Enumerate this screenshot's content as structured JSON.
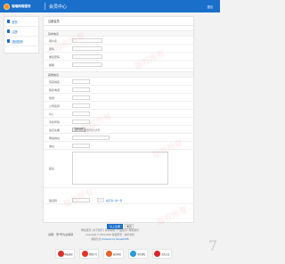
{
  "header": {
    "logo_text": "瑞瑞网络服务",
    "title": "会员中心",
    "exit_label": "退出"
  },
  "sidebar": {
    "items": [
      {
        "label": "首页",
        "icon": "home-icon"
      },
      {
        "label": "注册",
        "icon": "user-icon"
      },
      {
        "label": "找回密码",
        "icon": "key-icon"
      }
    ]
  },
  "main": {
    "title": "注册会员",
    "section_basic": "基本信息",
    "section_more": "其他信息",
    "fields": {
      "username": "用户名",
      "password": "密码",
      "confirm_password": "重复密码",
      "email": "邮箱",
      "realname": "真实姓名",
      "contact": "联系电话",
      "gender": "性别",
      "company": "公司名称",
      "qq": "QQ",
      "phone": "手机号码",
      "avatar": "会员头像",
      "homepage": "网站地址",
      "address": "地址",
      "intro": "备注",
      "captcha": "验证码"
    },
    "file_button": "选择文件",
    "file_status": "未选择任何文件",
    "captcha_link": "看不清？换一张",
    "submit_label": "马上注册",
    "reset_label": "重置",
    "tip": "说明：带*号为必填项"
  },
  "footer": {
    "line1": "网站首页 | 关于我们 | 新闻动态 | 产品展示 | 联系我们",
    "line2": "Copyright © 2019-2020 版权所有 · 技术支持",
    "line3_label": "备案信息",
    "line3_value": "Powered by SimpleCMS",
    "badges": [
      {
        "label": "网安备案",
        "color": "#d9312b"
      },
      {
        "label": "经营许可",
        "color": "#e0332a"
      },
      {
        "label": "诚信网站",
        "color": "#e8622b"
      },
      {
        "label": "可信网站",
        "color": "#2a9ad6"
      },
      {
        "label": "实名认证",
        "color": "#d9252a"
      }
    ]
  },
  "watermark": "版权所有",
  "corner_glyph": "7",
  "colors": {
    "brand": "#1a6fcb",
    "accent": "#ff8a1e"
  }
}
